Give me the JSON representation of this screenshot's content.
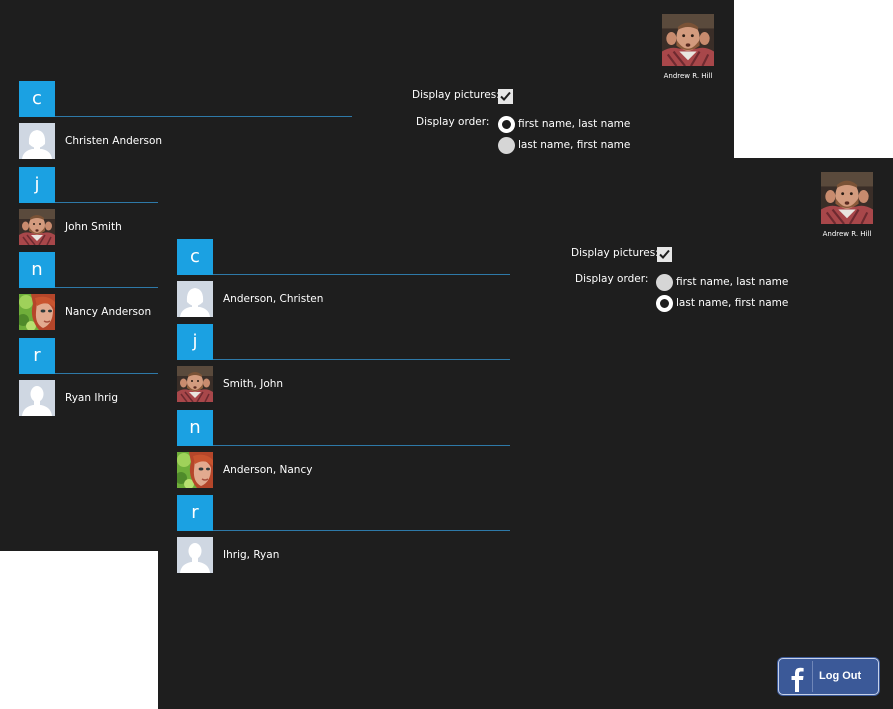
{
  "colors": {
    "background": "#1e1e1e",
    "accent": "#1ba1e2",
    "divider": "#2e79a8",
    "facebook": "#3b5998"
  },
  "user": {
    "name": "Andrew R. Hill",
    "avatar_icon": "user-photo-bearded-man"
  },
  "settings": {
    "display_pictures_label": "Display pictures:",
    "display_pictures_checked": true,
    "display_order_label": "Display order:",
    "order_options": [
      "first name, last name",
      "last name, first name"
    ]
  },
  "back_window": {
    "selected_order": "first name, last name",
    "groups": [
      {
        "letter": "c",
        "contact": "Christen Anderson",
        "avatar": "female-silhouette"
      },
      {
        "letter": "j",
        "contact": "John Smith",
        "avatar": "photo-john"
      },
      {
        "letter": "n",
        "contact": "Nancy Anderson",
        "avatar": "photo-nancy"
      },
      {
        "letter": "r",
        "contact": "Ryan Ihrig",
        "avatar": "male-silhouette"
      }
    ]
  },
  "front_window": {
    "selected_order": "last name, first name",
    "groups": [
      {
        "letter": "c",
        "contact": "Anderson, Christen",
        "avatar": "female-silhouette"
      },
      {
        "letter": "j",
        "contact": "Smith, John",
        "avatar": "photo-john"
      },
      {
        "letter": "n",
        "contact": "Anderson, Nancy",
        "avatar": "photo-nancy"
      },
      {
        "letter": "r",
        "contact": "Ihrig, Ryan",
        "avatar": "male-silhouette"
      }
    ],
    "logout_label": "Log Out",
    "facebook_icon": "facebook-f-icon"
  }
}
